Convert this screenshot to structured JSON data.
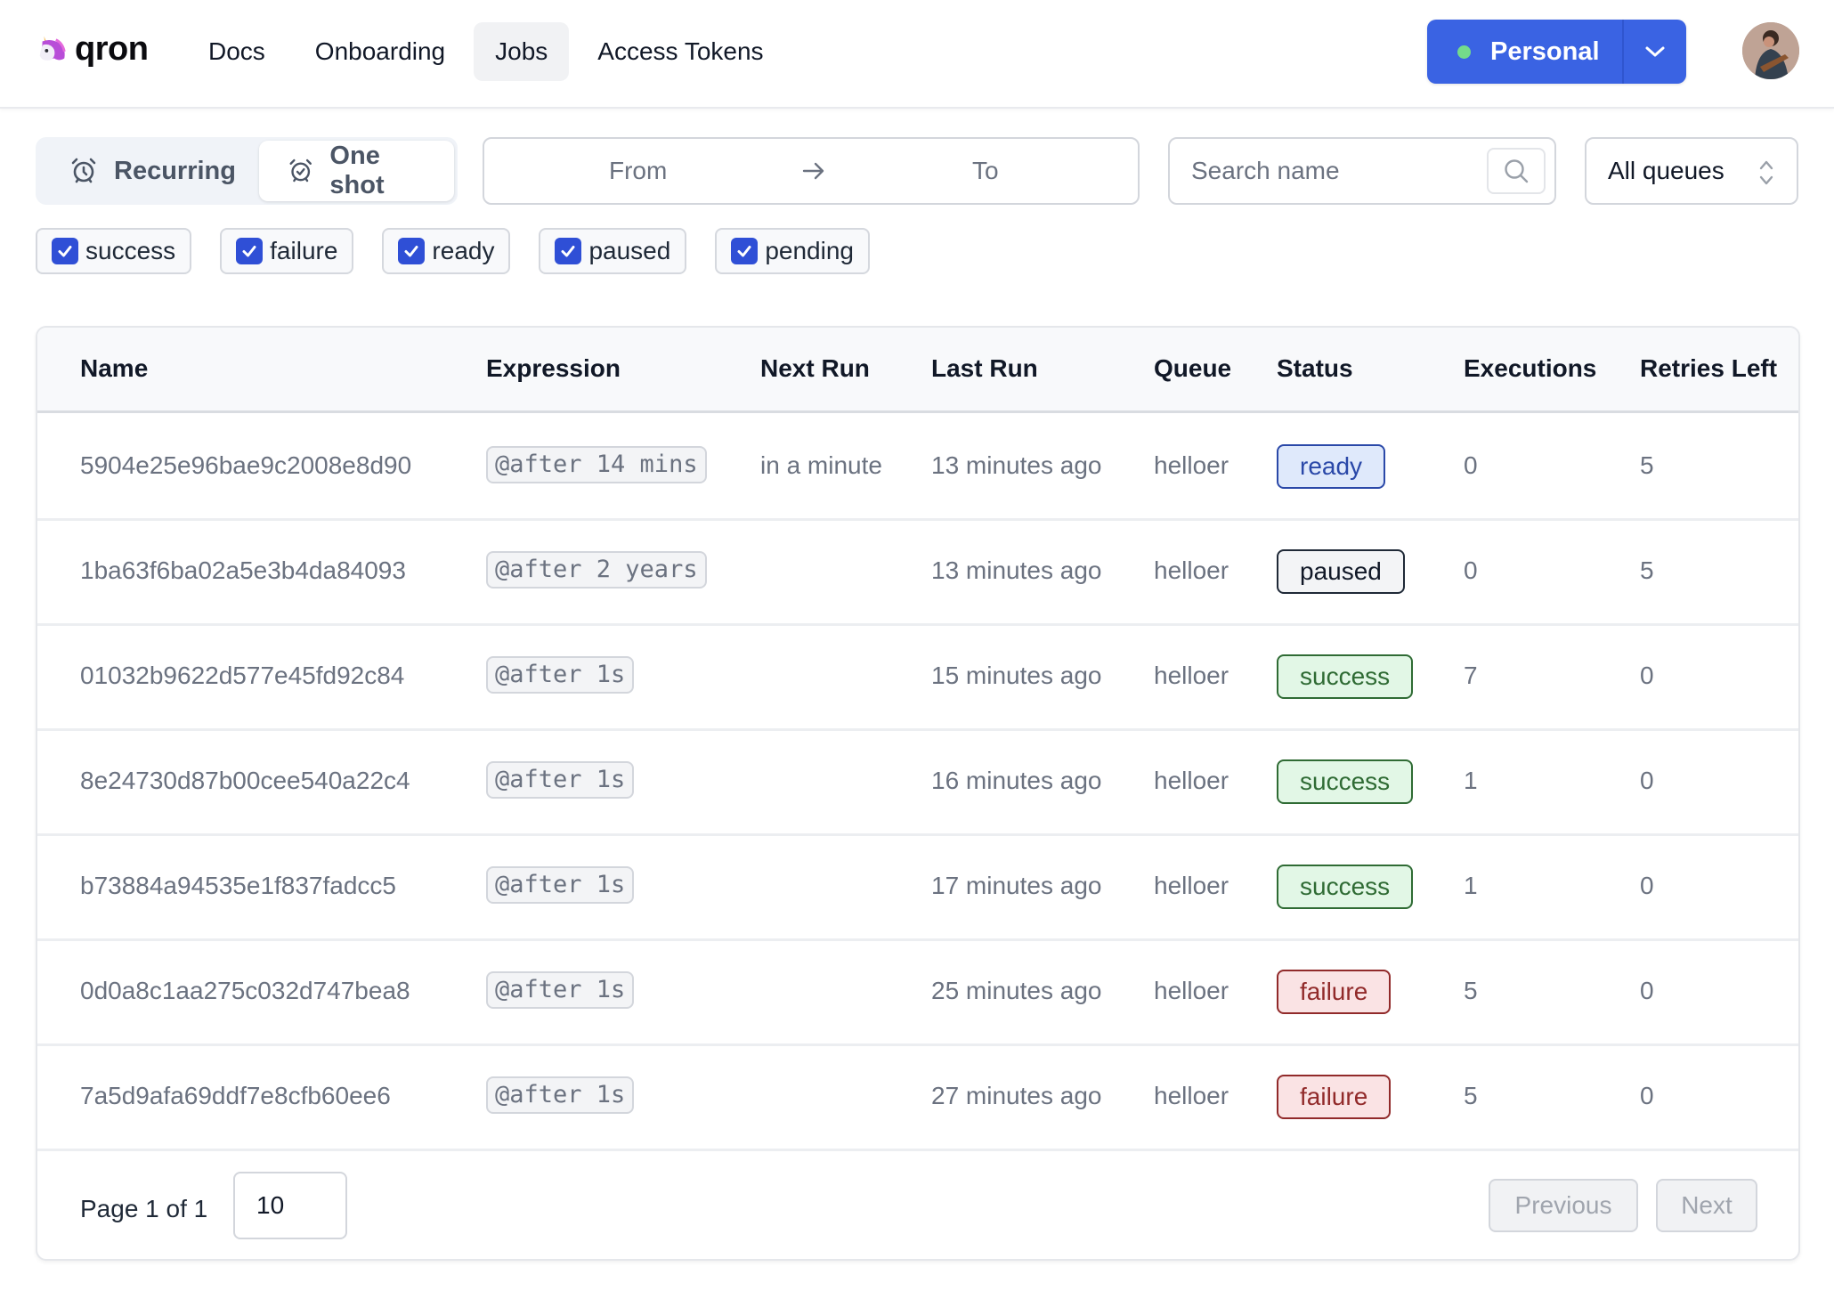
{
  "app": {
    "name": "qron",
    "logo_icon": "unicorn-icon"
  },
  "nav": {
    "items": [
      {
        "label": "Docs",
        "active": false
      },
      {
        "label": "Onboarding",
        "active": false
      },
      {
        "label": "Jobs",
        "active": true
      },
      {
        "label": "Access Tokens",
        "active": false
      }
    ]
  },
  "workspace": {
    "label": "Personal",
    "status_color": "#74db8b",
    "accent": "#3a63e3"
  },
  "filters": {
    "mode_tabs": [
      {
        "label": "Recurring",
        "icon": "alarm-clock-icon",
        "active": false
      },
      {
        "label": "One shot",
        "icon": "alarm-check-icon",
        "active": true
      }
    ],
    "date_range": {
      "from_placeholder": "From",
      "to_placeholder": "To"
    },
    "search": {
      "placeholder": "Search name",
      "value": ""
    },
    "queue_select": {
      "value": "All queues"
    },
    "status_chips": [
      {
        "label": "success",
        "checked": true
      },
      {
        "label": "failure",
        "checked": true
      },
      {
        "label": "ready",
        "checked": true
      },
      {
        "label": "paused",
        "checked": true
      },
      {
        "label": "pending",
        "checked": true
      }
    ]
  },
  "table": {
    "columns": [
      "Name",
      "Expression",
      "Next Run",
      "Last Run",
      "Queue",
      "Status",
      "Executions",
      "Retries Left"
    ],
    "rows": [
      {
        "name": "5904e25e96bae9c2008e8d90",
        "expression": "@after 14 mins",
        "next_run": "in a minute",
        "last_run": "13 minutes ago",
        "queue": "helloer",
        "status": "ready",
        "executions": "0",
        "retries_left": "5"
      },
      {
        "name": "1ba63f6ba02a5e3b4da84093",
        "expression": "@after 2 years",
        "next_run": "",
        "last_run": "13 minutes ago",
        "queue": "helloer",
        "status": "paused",
        "executions": "0",
        "retries_left": "5"
      },
      {
        "name": "01032b9622d577e45fd92c84",
        "expression": "@after 1s",
        "next_run": "",
        "last_run": "15 minutes ago",
        "queue": "helloer",
        "status": "success",
        "executions": "7",
        "retries_left": "0"
      },
      {
        "name": "8e24730d87b00cee540a22c4",
        "expression": "@after 1s",
        "next_run": "",
        "last_run": "16 minutes ago",
        "queue": "helloer",
        "status": "success",
        "executions": "1",
        "retries_left": "0"
      },
      {
        "name": "b73884a94535e1f837fadcc5",
        "expression": "@after 1s",
        "next_run": "",
        "last_run": "17 minutes ago",
        "queue": "helloer",
        "status": "success",
        "executions": "1",
        "retries_left": "0"
      },
      {
        "name": "0d0a8c1aa275c032d747bea8",
        "expression": "@after 1s",
        "next_run": "",
        "last_run": "25 minutes ago",
        "queue": "helloer",
        "status": "failure",
        "executions": "5",
        "retries_left": "0"
      },
      {
        "name": "7a5d9afa69ddf7e8cfb60ee6",
        "expression": "@after 1s",
        "next_run": "",
        "last_run": "27 minutes ago",
        "queue": "helloer",
        "status": "failure",
        "executions": "5",
        "retries_left": "0"
      }
    ]
  },
  "pagination": {
    "page_label": "Page 1 of 1",
    "page_size": "10",
    "previous_label": "Previous",
    "next_label": "Next"
  },
  "status_colors": {
    "ready": "#2a48a8",
    "paused": "#111827",
    "success": "#2f6b34",
    "failure": "#912a2a"
  }
}
